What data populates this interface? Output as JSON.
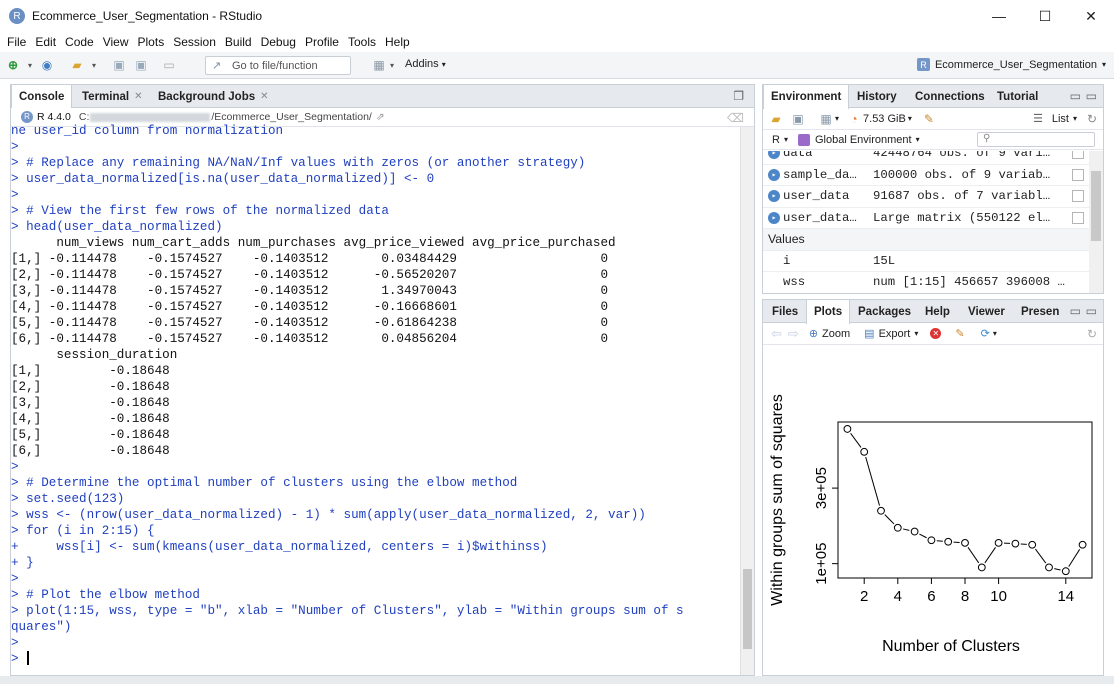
{
  "window": {
    "title": "Ecommerce_User_Segmentation - RStudio",
    "logo_letter": "R",
    "controls": {
      "minimize": "—",
      "maximize": "☐",
      "close": "✕"
    }
  },
  "menu": [
    "File",
    "Edit",
    "Code",
    "View",
    "Plots",
    "Session",
    "Build",
    "Debug",
    "Profile",
    "Tools",
    "Help"
  ],
  "toolbar": {
    "goto_placeholder": "Go to file/function",
    "addins_label": "Addins",
    "project_label": "Ecommerce_User_Segmentation",
    "project_icon_letter": "R"
  },
  "console": {
    "tabs": [
      {
        "label": "Console",
        "closable": false
      },
      {
        "label": "Terminal",
        "closable": true
      },
      {
        "label": "Background Jobs",
        "closable": true
      }
    ],
    "r_version": "R 4.4.0",
    "path_prefix": "C:",
    "path_suffix": "/Ecommerce_User_Segmentation/",
    "lines": [
      {
        "t": "ne user_id column from normalization",
        "k": "cmd"
      },
      {
        "t": ">",
        "k": "cmd"
      },
      {
        "t": "> # Replace any remaining NA/NaN/Inf values with zeros (or another strategy)",
        "k": "cmd"
      },
      {
        "t": "> user_data_normalized[is.na(user_data_normalized)] <- 0",
        "k": "cmd"
      },
      {
        "t": ">",
        "k": "cmd"
      },
      {
        "t": "> # View the first few rows of the normalized data",
        "k": "cmd"
      },
      {
        "t": "> head(user_data_normalized)",
        "k": "cmd"
      },
      {
        "t": "      num_views num_cart_adds num_purchases avg_price_viewed avg_price_purchased",
        "k": "out"
      },
      {
        "t": "[1,] -0.114478    -0.1574527    -0.1403512       0.03484429                   0",
        "k": "out"
      },
      {
        "t": "[2,] -0.114478    -0.1574527    -0.1403512      -0.56520207                   0",
        "k": "out"
      },
      {
        "t": "[3,] -0.114478    -0.1574527    -0.1403512       1.34970043                   0",
        "k": "out"
      },
      {
        "t": "[4,] -0.114478    -0.1574527    -0.1403512      -0.16668601                   0",
        "k": "out"
      },
      {
        "t": "[5,] -0.114478    -0.1574527    -0.1403512      -0.61864238                   0",
        "k": "out"
      },
      {
        "t": "[6,] -0.114478    -0.1574527    -0.1403512       0.04856204                   0",
        "k": "out"
      },
      {
        "t": "      session_duration",
        "k": "out"
      },
      {
        "t": "[1,]         -0.18648",
        "k": "out"
      },
      {
        "t": "[2,]         -0.18648",
        "k": "out"
      },
      {
        "t": "[3,]         -0.18648",
        "k": "out"
      },
      {
        "t": "[4,]         -0.18648",
        "k": "out"
      },
      {
        "t": "[5,]         -0.18648",
        "k": "out"
      },
      {
        "t": "[6,]         -0.18648",
        "k": "out"
      },
      {
        "t": ">",
        "k": "cmd"
      },
      {
        "t": "> # Determine the optimal number of clusters using the elbow method",
        "k": "cmd"
      },
      {
        "t": "> set.seed(123)",
        "k": "cmd"
      },
      {
        "t": "> wss <- (nrow(user_data_normalized) - 1) * sum(apply(user_data_normalized, 2, var))",
        "k": "cmd"
      },
      {
        "t": "> for (i in 2:15) {",
        "k": "cmd"
      },
      {
        "t": "+     wss[i] <- sum(kmeans(user_data_normalized, centers = i)$withinss)",
        "k": "cmd"
      },
      {
        "t": "+ }",
        "k": "cmd"
      },
      {
        "t": ">",
        "k": "cmd"
      },
      {
        "t": "> # Plot the elbow method",
        "k": "cmd"
      },
      {
        "t": "> plot(1:15, wss, type = \"b\", xlab = \"Number of Clusters\", ylab = \"Within groups sum of s",
        "k": "cmd"
      },
      {
        "t": "quares\")",
        "k": "cmd"
      },
      {
        "t": ">",
        "k": "cmd"
      },
      {
        "t": "> ",
        "k": "cmd"
      }
    ]
  },
  "environment": {
    "tabs": [
      "Environment",
      "History",
      "Connections",
      "Tutorial"
    ],
    "memory": "7.53 GiB",
    "view_mode": "List",
    "lang": "R",
    "scope": "Global Environment",
    "rows": [
      {
        "name": "data",
        "value": "42448764 obs. of 9 vari…",
        "type": "data"
      },
      {
        "name": "sample_da…",
        "value": "100000 obs. of 9 variab…",
        "type": "data"
      },
      {
        "name": "user_data",
        "value": "91687 obs. of 7 variabl…",
        "type": "data"
      },
      {
        "name": "user_data…",
        "value": "Large matrix (550122 el…",
        "type": "data"
      },
      {
        "name": "Values",
        "value": "",
        "type": "section"
      },
      {
        "name": "i",
        "value": "15L",
        "type": "value"
      },
      {
        "name": "wss",
        "value": "num [1:15] 456657 396008 …",
        "type": "value"
      }
    ]
  },
  "plots": {
    "tabs": [
      "Files",
      "Plots",
      "Packages",
      "Help",
      "Viewer",
      "Presen"
    ],
    "zoom_label": "Zoom",
    "export_label": "Export"
  },
  "chart_data": {
    "type": "line",
    "markers": "open-circle",
    "x": [
      1,
      2,
      3,
      4,
      5,
      6,
      7,
      8,
      9,
      10,
      11,
      12,
      13,
      14,
      15
    ],
    "y": [
      456657,
      396008,
      240000,
      195000,
      185000,
      162000,
      158000,
      155000,
      90000,
      155000,
      153000,
      150000,
      90000,
      80000,
      150000
    ],
    "xlabel": "Number of Clusters",
    "ylabel": "Within groups sum of squares",
    "xticks": [
      2,
      4,
      6,
      8,
      10,
      14
    ],
    "xtick_labels": [
      "2",
      "4",
      "6",
      "8",
      "10",
      "14"
    ],
    "yticks": [
      100000,
      300000
    ],
    "ytick_labels": [
      "1e+05",
      "3e+05"
    ],
    "xlim": [
      0.44,
      15.56
    ],
    "ylim": [
      62000,
      475000
    ],
    "grid": false
  }
}
